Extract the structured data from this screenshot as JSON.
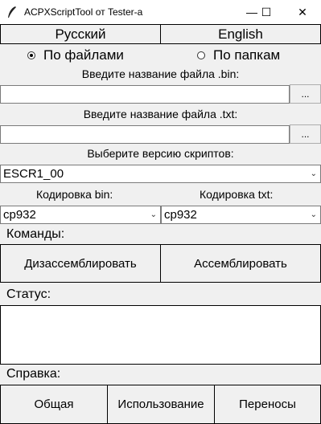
{
  "window": {
    "title": "ACPXScriptTool от Tester-a",
    "minimize_glyph": "—",
    "maximize_glyph": "☐",
    "close_glyph": "✕"
  },
  "languages": [
    "Русский",
    "English"
  ],
  "mode": {
    "options": [
      "По файлами",
      "По папкам"
    ],
    "selected": "По файлами"
  },
  "bin_file": {
    "label": "Введите название файла .bin:",
    "value": "",
    "browse_label": "..."
  },
  "txt_file": {
    "label": "Введите название файла .txt:",
    "value": "",
    "browse_label": "..."
  },
  "script_version": {
    "label": "Выберите версию скриптов:",
    "value": "ESCR1_00"
  },
  "encoding": {
    "bin_label": "Кодировка bin:",
    "txt_label": "Кодировка txt:",
    "bin_value": "cp932",
    "txt_value": "cp932"
  },
  "commands": {
    "label": "Команды:",
    "disassemble": "Дизассемблировать",
    "assemble": "Ассемблировать"
  },
  "status": {
    "label": "Статус:",
    "text": ""
  },
  "help": {
    "label": "Справка:",
    "general": "Общая",
    "usage": "Использование",
    "wrapping": "Переносы"
  },
  "icons": {
    "app": "feather-icon",
    "dropdown": "chevron-down-icon"
  }
}
